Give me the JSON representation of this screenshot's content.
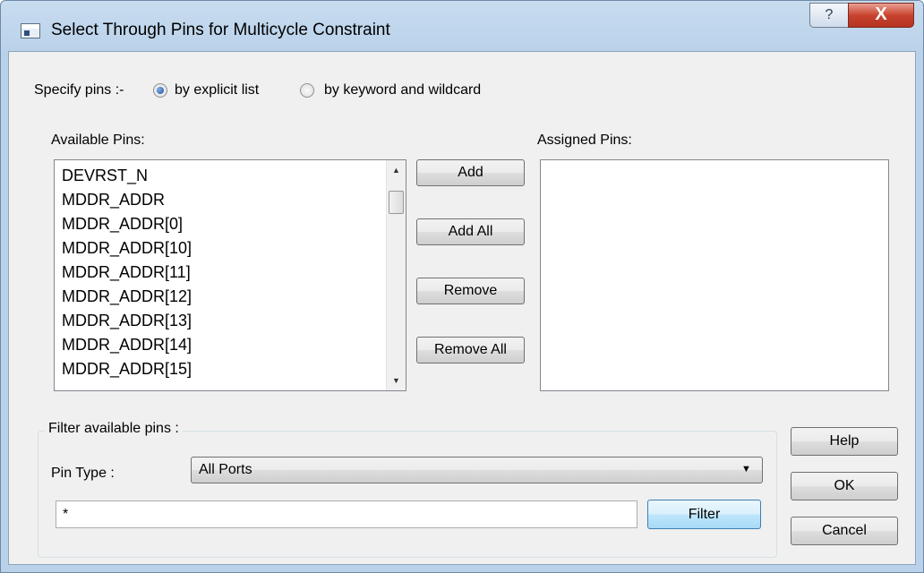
{
  "window": {
    "title": "Select Through Pins for Multicycle Constraint",
    "help_glyph": "?",
    "close_glyph": "X"
  },
  "specify": {
    "label": "Specify pins :-",
    "options": [
      {
        "label": "by explicit list",
        "checked": true
      },
      {
        "label": "by keyword and wildcard",
        "checked": false
      }
    ]
  },
  "available": {
    "label": "Available Pins:",
    "items": [
      "DEVRST_N",
      "MDDR_ADDR",
      "MDDR_ADDR[0]",
      "MDDR_ADDR[10]",
      "MDDR_ADDR[11]",
      "MDDR_ADDR[12]",
      "MDDR_ADDR[13]",
      "MDDR_ADDR[14]",
      "MDDR_ADDR[15]"
    ]
  },
  "assigned": {
    "label": "Assigned Pins:",
    "items": []
  },
  "buttons": {
    "add": "Add",
    "add_all": "Add All",
    "remove": "Remove",
    "remove_all": "Remove All",
    "help": "Help",
    "ok": "OK",
    "cancel": "Cancel"
  },
  "filter": {
    "group_label": "Filter available pins :",
    "pin_type_label": "Pin Type :",
    "pin_type_value": "All Ports",
    "pattern": "*",
    "button": "Filter"
  }
}
